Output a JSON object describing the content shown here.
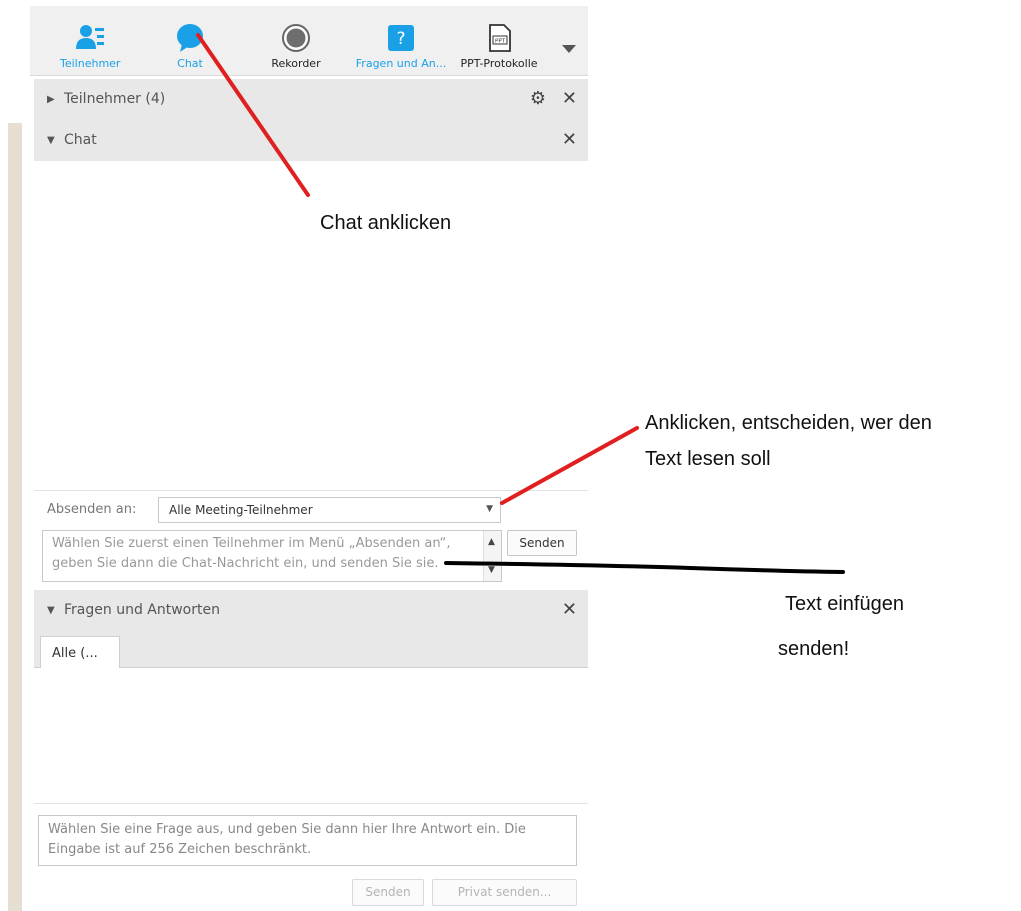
{
  "toolbar": {
    "items": [
      {
        "label": "Teilnehmer",
        "icon": "participants-icon",
        "color": "#1aa0e6"
      },
      {
        "label": "Chat",
        "icon": "chat-bubble-icon",
        "color": "#1aa0e6"
      },
      {
        "label": "Rekorder",
        "icon": "record-icon",
        "color": "#222222"
      },
      {
        "label": "Fragen und An...",
        "icon": "question-icon",
        "color": "#1aa0e6"
      },
      {
        "label": "PPT-Protokolle",
        "icon": "ppt-file-icon",
        "color": "#222222"
      }
    ],
    "more_icon": "dropdown-triangle-icon"
  },
  "panels": {
    "participants": {
      "title": "Teilnehmer (4)",
      "expanded": false
    },
    "chat": {
      "title": "Chat",
      "expanded": true,
      "send_to_label": "Absenden an:",
      "send_to_value": "Alle Meeting-Teilnehmer",
      "message_placeholder": "Wählen Sie zuerst einen Teilnehmer im Menü „Absenden an“, geben Sie dann die Chat-Nachricht ein, und senden Sie sie.",
      "send_label": "Senden"
    },
    "qa": {
      "title": "Fragen und Antworten",
      "expanded": true,
      "tab_label": "Alle (...",
      "answer_placeholder": "Wählen Sie eine Frage aus, und geben Sie dann hier Ihre Antwort ein. Die Eingabe ist auf 256 Zeichen beschränkt.",
      "send_label": "Senden",
      "private_send_label": "Privat senden..."
    }
  },
  "annotations": {
    "chat_click": "Chat anklicken",
    "recipient_line1": "Anklicken, entscheiden, wer den",
    "recipient_line2": "Text lesen soll",
    "insert_text": "Text einfügen",
    "send": "senden!"
  },
  "colors": {
    "accent": "#1aa0e6",
    "annotation_red": "#e02020",
    "annotation_black": "#000000",
    "header_bg": "#e8e8e8",
    "toolbar_bg": "#f0f0f0",
    "left_strip": "#e6ded0"
  }
}
